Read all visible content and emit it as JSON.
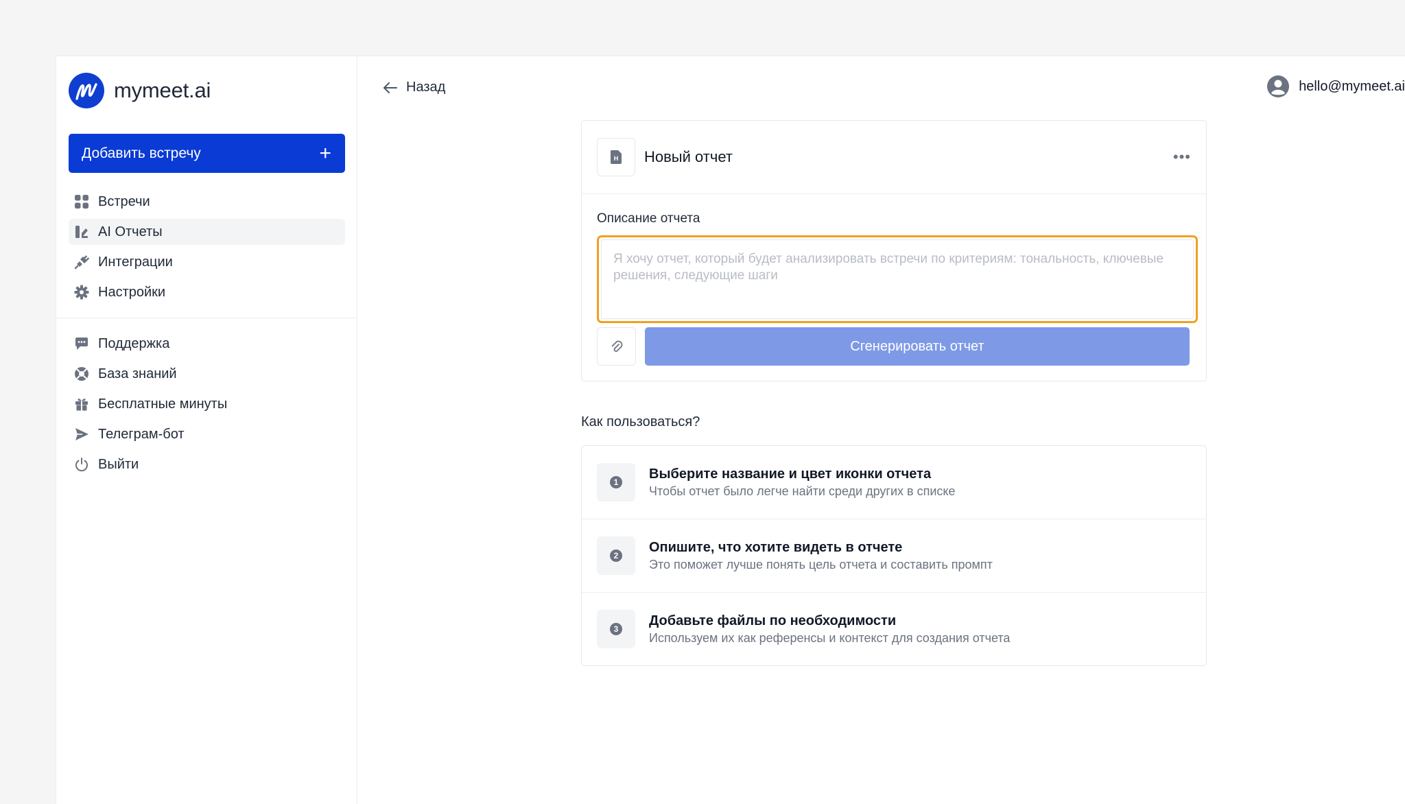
{
  "brand": {
    "name": "mymeet.ai",
    "color": "#0a3bd4"
  },
  "sidebar": {
    "add_button": "Добавить встречу",
    "primary": [
      {
        "label": "Встречи",
        "icon": "grid-icon"
      },
      {
        "label": "AI Отчеты",
        "icon": "report-icon",
        "active": true
      },
      {
        "label": "Интеграции",
        "icon": "plug-icon"
      },
      {
        "label": "Настройки",
        "icon": "gear-icon"
      }
    ],
    "secondary": [
      {
        "label": "Поддержка",
        "icon": "chat-icon"
      },
      {
        "label": "База знаний",
        "icon": "lifebuoy-icon"
      },
      {
        "label": "Бесплатные минуты",
        "icon": "gift-icon"
      },
      {
        "label": "Телеграм-бот",
        "icon": "send-icon"
      },
      {
        "label": "Выйти",
        "icon": "power-icon"
      }
    ]
  },
  "topbar": {
    "back_label": "Назад",
    "user_email": "hello@mymeet.ai"
  },
  "report": {
    "title": "Новый отчет",
    "field_label": "Описание отчета",
    "placeholder": "Я хочу отчет, который будет анализировать встречи по критериям: тональность, ключевые решения, следующие шаги",
    "value": "",
    "generate_label": "Сгенерировать отчет",
    "focus_color": "#f0a020"
  },
  "howto": {
    "title": "Как пользоваться?",
    "steps": [
      {
        "num": "1",
        "title": "Выберите название и цвет иконки отчета",
        "sub": "Чтобы отчет было легче найти среди других в списке"
      },
      {
        "num": "2",
        "title": "Опишите, что хотите видеть в отчете",
        "sub": "Это поможет лучше понять цель отчета и составить промпт"
      },
      {
        "num": "3",
        "title": "Добавьте файлы по необходимости",
        "sub": "Используем их как референсы и контекст для создания отчета"
      }
    ]
  }
}
